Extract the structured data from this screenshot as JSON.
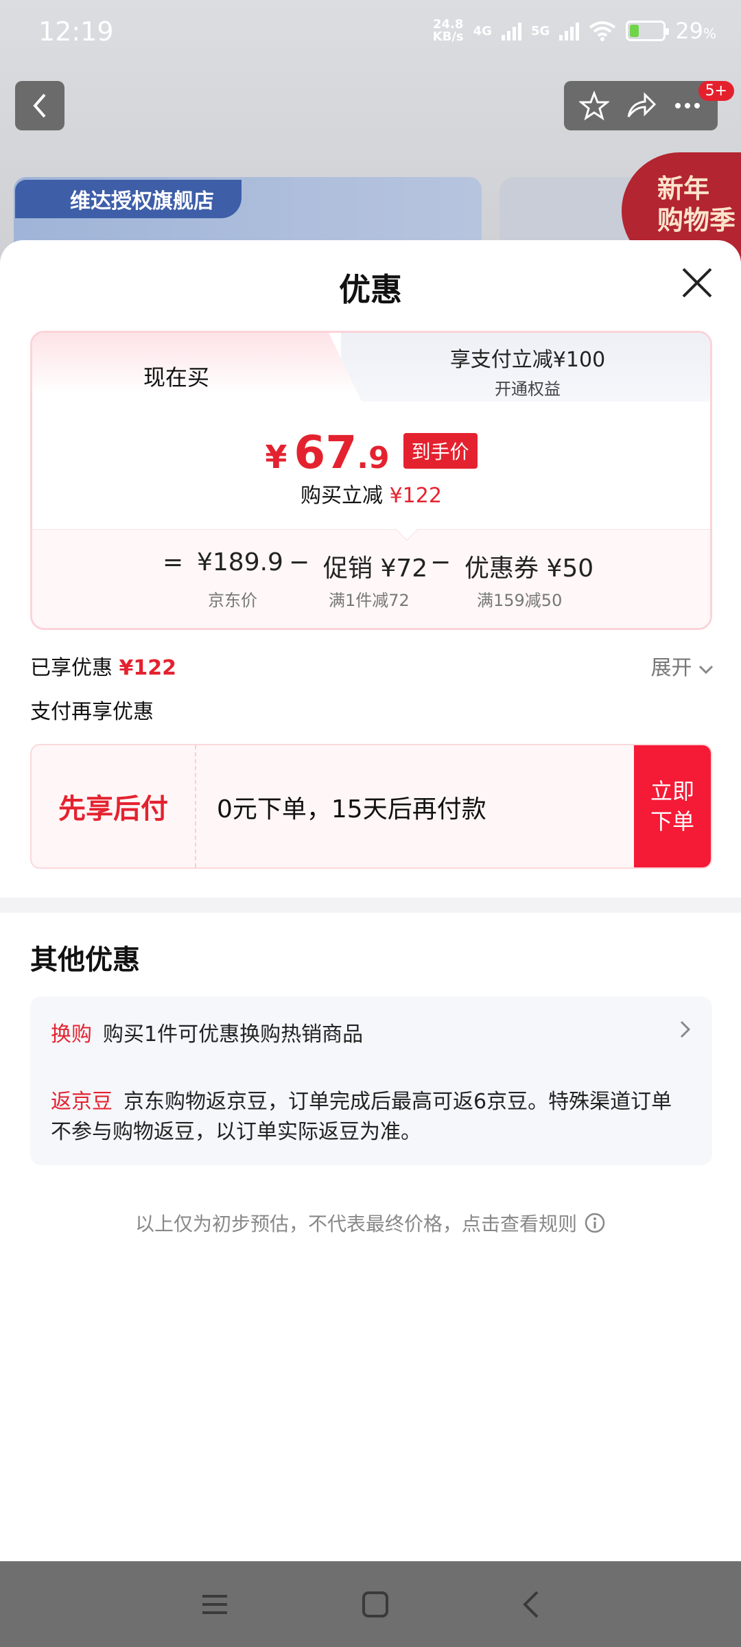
{
  "status_bar": {
    "time": "12:19",
    "net_speed_value": "24.8",
    "net_speed_unit": "KB/s",
    "sig1": "4G",
    "sig2": "5G",
    "battery_pct": "29",
    "battery_level": 0.29,
    "pct_sign": "%"
  },
  "header": {
    "cart_badge": "5+",
    "store_name": "维达授权旗舰店",
    "promo": [
      "新年",
      "购物季"
    ]
  },
  "sheet": {
    "title": "优惠",
    "tabs": {
      "active": "现在买",
      "inactive_title": "享支付立减¥100",
      "inactive_sub": "开通权益"
    },
    "final_price": {
      "currency": "¥",
      "integer": "67",
      "decimal": ".9",
      "tag": "到手价"
    },
    "saving_label": "购买立减",
    "saving_value": "¥122",
    "calc": {
      "equals": "=",
      "base_price": "¥189.9",
      "base_label": "京东价",
      "minus1": "−",
      "promo_price": "促销 ¥72",
      "promo_label": "满1件减72",
      "minus2": "−",
      "coupon_price": "优惠券 ¥50",
      "coupon_label": "满159减50"
    },
    "enjoyed_label": "已享优惠",
    "enjoyed_value": "¥122",
    "expand_label": "展开",
    "pay_more_label": "支付再享优惠",
    "bnpl": {
      "label": "先享后付",
      "desc": "0元下单，15天后再付款",
      "button": "立即下单"
    },
    "other": {
      "title": "其他优惠",
      "row1_tag": "换购",
      "row1_text": "购买1件可优惠换购热销商品",
      "row2_tag": "返京豆",
      "row2_text": "京东购物返京豆，订单完成后最高可返6京豆。特殊渠道订单不参与购物返豆，以订单实际返豆为准。"
    },
    "disclaimer": "以上仅为初步预估，不代表最终价格，点击查看规则"
  },
  "icons": {
    "back": "chevron-left-icon",
    "star": "star-icon",
    "share": "share-icon",
    "more": "more-icon",
    "close": "close-icon",
    "info": "info-icon"
  },
  "colors": {
    "accent_red": "#e4222f",
    "button_red": "#f51a36"
  }
}
